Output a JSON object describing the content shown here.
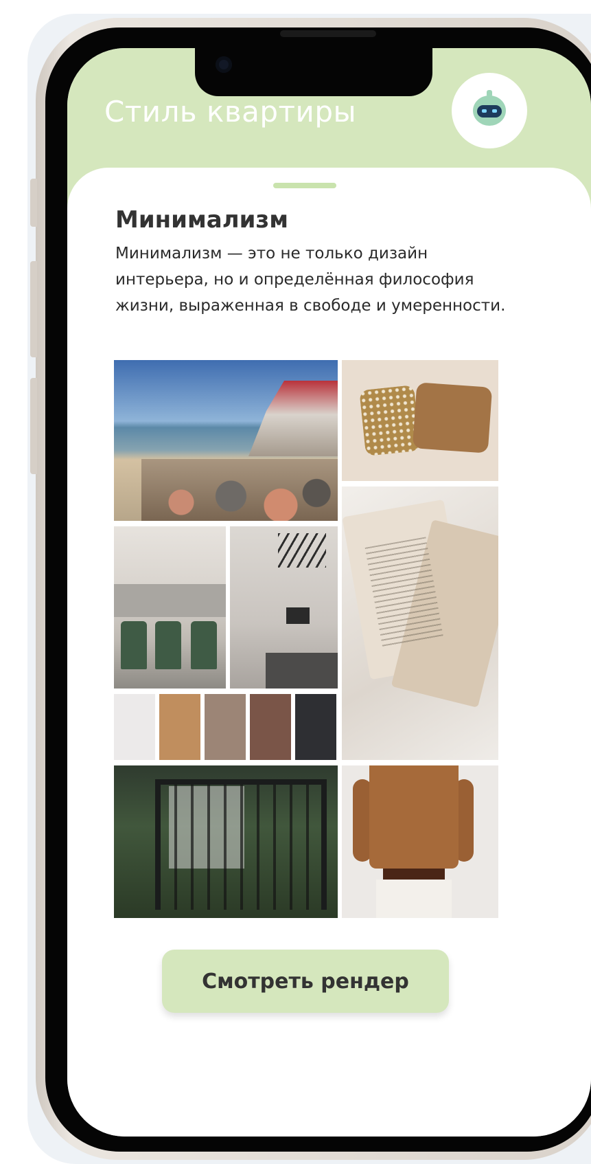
{
  "header": {
    "title": "Стиль квартиры",
    "assistant_icon": "robot-assistant-icon"
  },
  "style_card": {
    "name": "Минимализм",
    "description": "Минимализм — это не только дизайн интерьера, но и определённая философия жизни, выраженная в свободе и умеренности."
  },
  "moodboard": {
    "images": [
      "beach-image",
      "pillows-image",
      "open-book-image",
      "dining-room-image",
      "bedroom-image",
      "garden-pergola-image",
      "brown-sweater-image"
    ],
    "palette": [
      "#eceaea",
      "#c08e5e",
      "#9c8576",
      "#7a5548",
      "#2e2f33"
    ]
  },
  "actions": {
    "render_button_label": "Смотреть рендер"
  },
  "colors": {
    "accent": "#d5e7bd"
  }
}
